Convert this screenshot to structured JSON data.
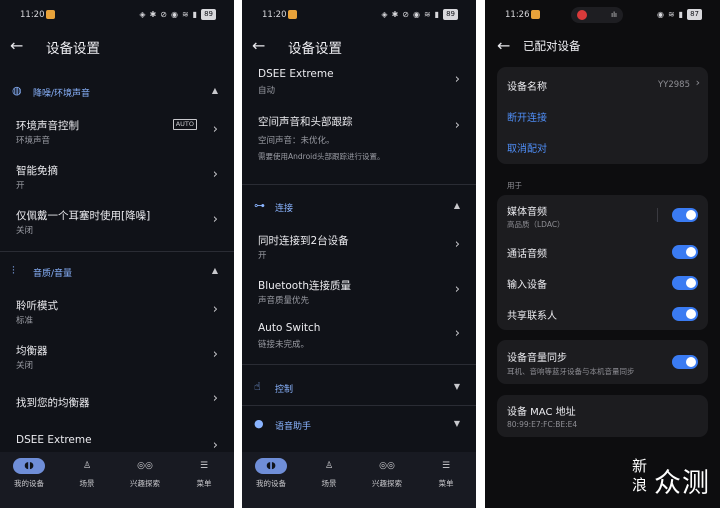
{
  "panel1": {
    "status": {
      "time": "11:20",
      "battery": "89"
    },
    "title": "设备设置",
    "sections": [
      {
        "label": "降噪/环境声音",
        "toggle": "▲"
      },
      {
        "label": "音质/音量",
        "toggle": "▲"
      }
    ],
    "rows": [
      {
        "title": "环境声音控制",
        "sub": "环境声音",
        "badge": "AUTO"
      },
      {
        "title": "智能免摘",
        "sub": "开"
      },
      {
        "title": "仅佩戴一个耳塞时使用[降噪]",
        "sub": "关闭"
      },
      {
        "title": "聆听模式",
        "sub": "标准"
      },
      {
        "title": "均衡器",
        "sub": "关闭"
      },
      {
        "title": "找到您的均衡器",
        "sub": ""
      },
      {
        "title": "DSEE Extreme",
        "sub": ""
      }
    ]
  },
  "panel2": {
    "status": {
      "time": "11:20",
      "battery": "89"
    },
    "title": "设备设置",
    "rows": [
      {
        "title": "DSEE Extreme",
        "sub": "自动"
      },
      {
        "title": "空间声音和头部跟踪",
        "sub": "空间声音：未优化。",
        "note": "需要使用Android头部跟踪进行设置。"
      },
      {
        "title": "同时连接到2台设备",
        "sub": "开"
      },
      {
        "title": "Bluetooth连接质量",
        "sub": "声音质量优先"
      },
      {
        "title": "Auto Switch",
        "sub": "链接未完成。"
      }
    ],
    "sections": [
      {
        "label": "连接",
        "toggle": "▲"
      },
      {
        "label": "控制",
        "toggle": "▼"
      },
      {
        "label": "语音助手",
        "toggle": "▼"
      }
    ]
  },
  "nav": [
    {
      "label": "我的设备",
      "icon": "headphones-icon",
      "glyph": "◖◗",
      "active": true
    },
    {
      "label": "场景",
      "icon": "walking-icon",
      "glyph": "🚶",
      "active": false
    },
    {
      "label": "兴趣探索",
      "icon": "binoculars-icon",
      "glyph": "◎◎",
      "active": false
    },
    {
      "label": "菜单",
      "icon": "menu-icon",
      "glyph": "☰",
      "active": false
    }
  ],
  "panel3": {
    "status": {
      "time": "11:26",
      "battery": "87",
      "call": "·"
    },
    "title": "已配对设备",
    "device_name_label": "设备名称",
    "device_name_value": "YY2985",
    "disconnect": "断开连接",
    "unpair": "取消配对",
    "group_label": "用于",
    "features": [
      {
        "title": "媒体音频",
        "sub": "高品质（LDAC）",
        "on": true
      },
      {
        "title": "通话音频",
        "sub": "",
        "on": true
      },
      {
        "title": "输入设备",
        "sub": "",
        "on": true
      },
      {
        "title": "共享联系人",
        "sub": "",
        "on": true
      }
    ],
    "volume_sync": {
      "title": "设备音量同步",
      "sub": "耳机、音响等蓝牙设备与本机音量同步",
      "on": true
    },
    "mac": {
      "title": "设备 MAC 地址",
      "value": "80:99:E7:FC:BE:E4"
    }
  },
  "watermark": {
    "small": "新浪",
    "big": "众测"
  },
  "colors": {
    "accent": "#8ab4ff",
    "toggle_on": "#3a7bf2",
    "link": "#4f8ef7"
  }
}
